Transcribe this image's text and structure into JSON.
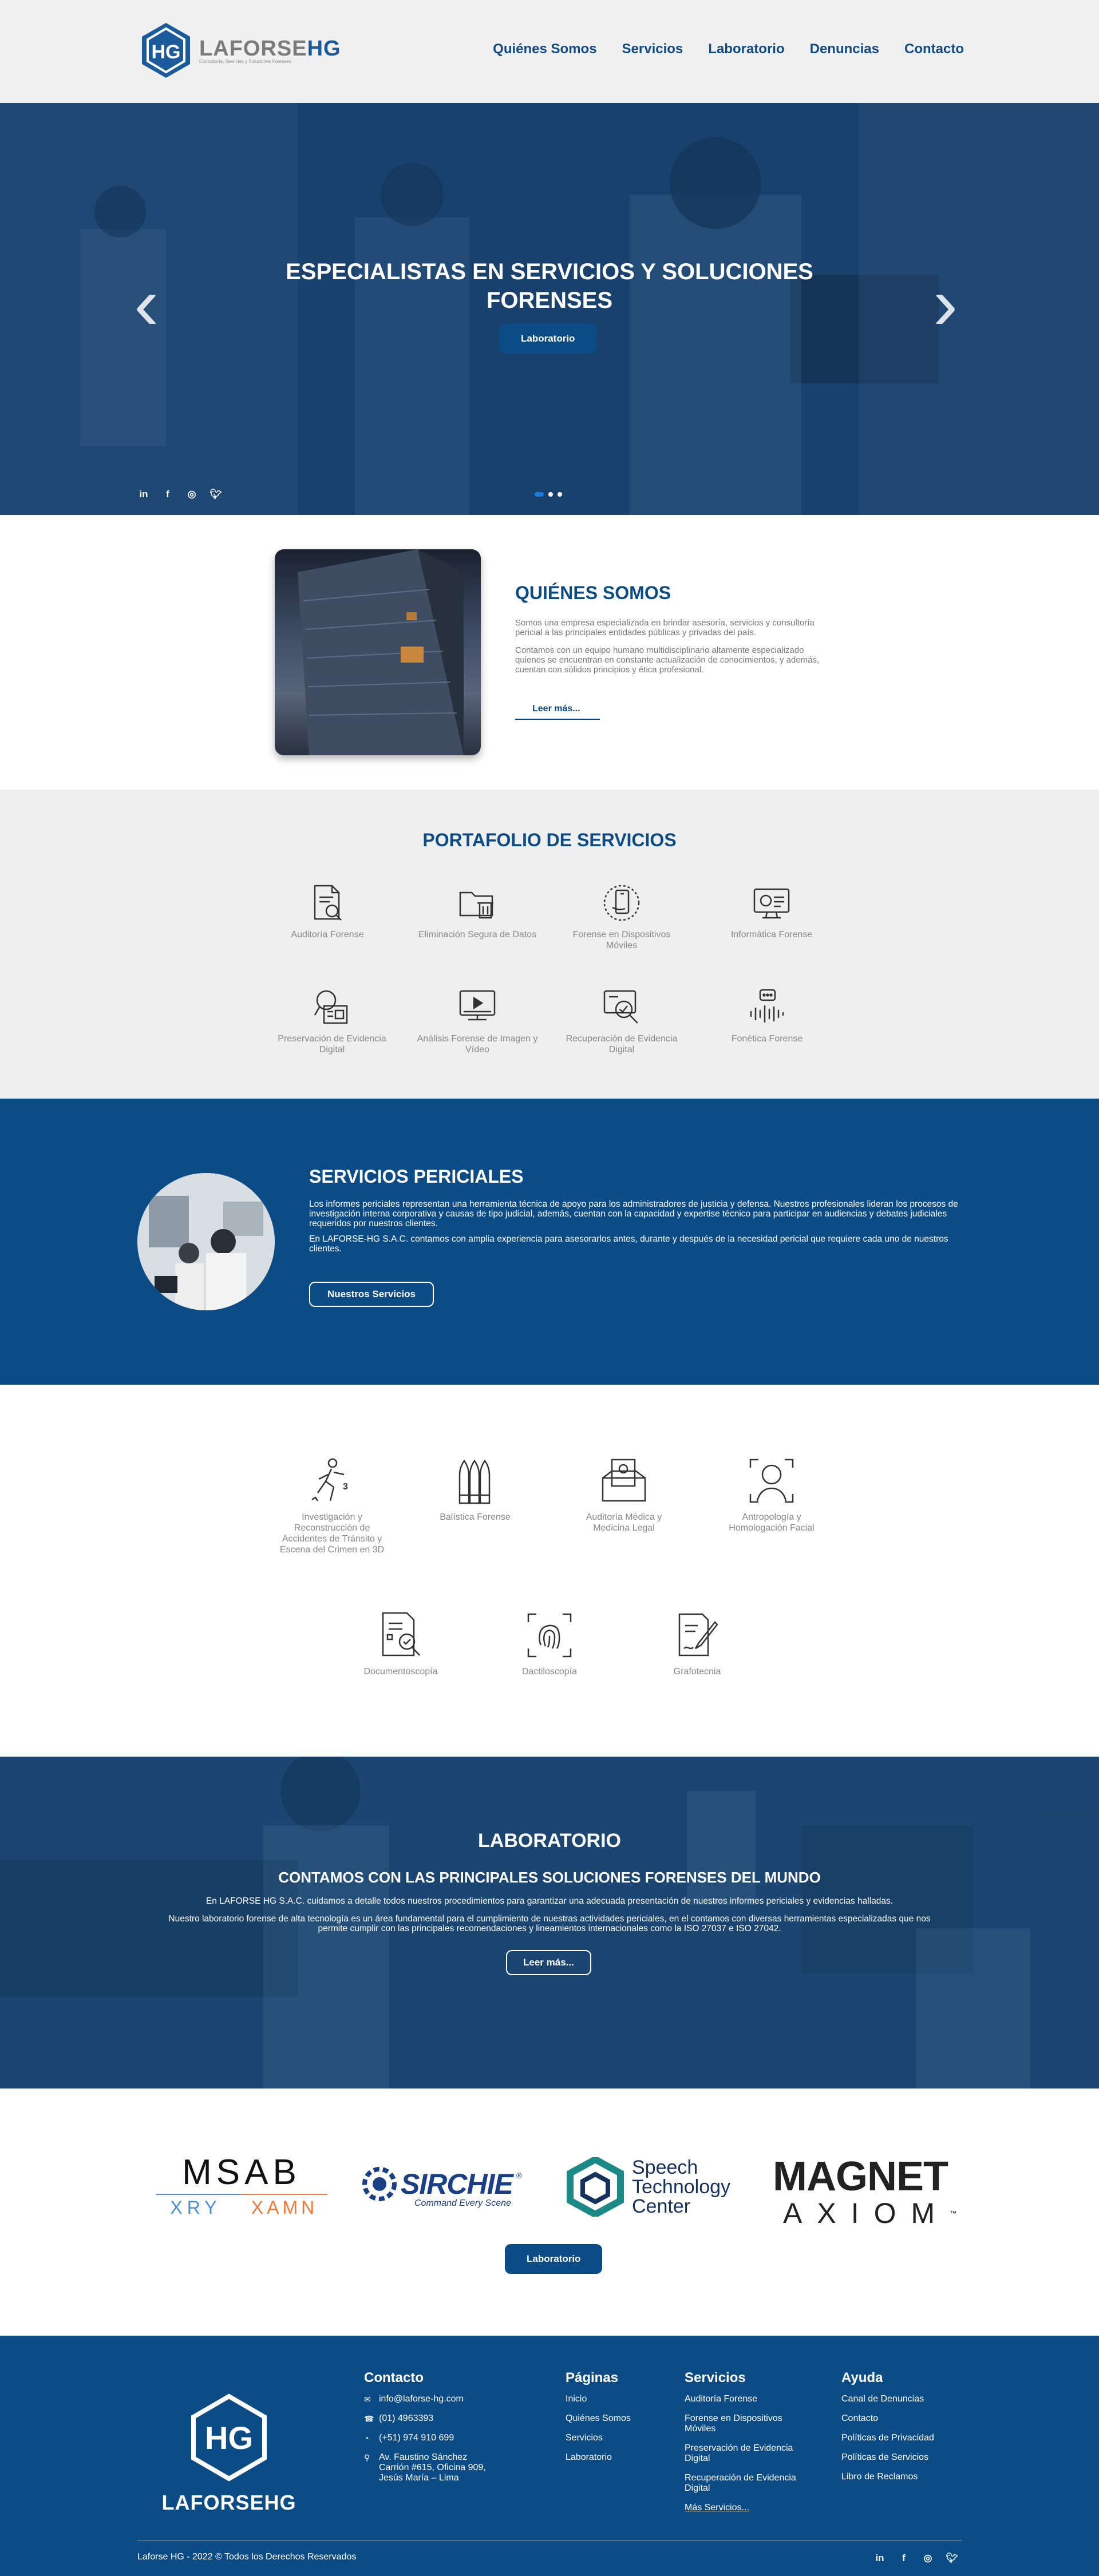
{
  "header": {
    "logo_text_a": "LAFORSE",
    "logo_text_b": "HG",
    "logo_sub": "Consultoría, Servicios y Soluciones Forenses",
    "nav": [
      "Quiénes Somos",
      "Servicios",
      "Laboratorio",
      "Denuncias",
      "Contacto"
    ]
  },
  "hero": {
    "title": "ESPECIALISTAS EN SERVICIOS Y SOLUCIONES FORENSES",
    "button": "Laboratorio",
    "prev_arrow": "‹",
    "next_arrow": "›",
    "slides": 3,
    "active_slide": 1
  },
  "about": {
    "title": "QUIÉNES SOMOS",
    "p1": "Somos una empresa especializada en brindar asesoría, servicios y consultoría pericial a las principales entidades públicas y privadas del país.",
    "p2": "Contamos con un equipo humano multidisciplinario altamente especializado quienes se encuentran en constante actualización de conocimientos, y además, cuentan con sólidos principios y ética profesional.",
    "link": "Leer más..."
  },
  "portfolio": {
    "title": "PORTAFOLIO DE SERVICIOS",
    "items": [
      {
        "label": "Auditoría Forense",
        "icon": "audit-icon"
      },
      {
        "label": "Eliminación Segura de Datos",
        "icon": "delete-folder-icon"
      },
      {
        "label": "Forense en Dispositivos Móviles",
        "icon": "mobile-forensic-icon"
      },
      {
        "label": "Informática Forense",
        "icon": "computer-forensic-icon"
      },
      {
        "label": "Preservación de Evidencia Digital",
        "icon": "preservation-icon"
      },
      {
        "label": "Análisis Forense de Imagen y Vídeo",
        "icon": "video-analysis-icon"
      },
      {
        "label": "Recuperación de Evidencia Digital",
        "icon": "recovery-icon"
      },
      {
        "label": "Fonética Forense",
        "icon": "phonetic-icon"
      }
    ]
  },
  "periciales": {
    "title": "SERVICIOS PERICIALES",
    "p1": "Los informes periciales representan una herramienta técnica de apoyo para los administradores de justicia y defensa. Nuestros profesionales lideran los procesos de investigación interna corporativa y causas de tipo judicial, además, cuentan con la capacidad y expertise técnico para participar en audiencias y debates judiciales requeridos por nuestros clientes.",
    "p2": "En LAFORSE-HG S.A.C. contamos con amplia experiencia para asesorarlos antes, durante y después de la necesidad pericial que requiere cada uno de nuestros clientes.",
    "button": "Nuestros Servicios",
    "items": [
      {
        "label": "Investigación y Reconstrucción de Accidentes de Tránsito y Escena del Crimen en 3D",
        "icon": "crime-scene-icon"
      },
      {
        "label": "Balística Forense",
        "icon": "ballistics-icon"
      },
      {
        "label": "Auditoría Médica y Medicina Legal",
        "icon": "medical-audit-icon"
      },
      {
        "label": "Antropología y Homologación Facial",
        "icon": "facial-icon"
      },
      {
        "label": "Documentoscopía",
        "icon": "document-icon"
      },
      {
        "label": "Dactiloscopía",
        "icon": "fingerprint-icon"
      },
      {
        "label": "Grafotecnia",
        "icon": "handwriting-icon"
      }
    ]
  },
  "laboratorio": {
    "title": "LABORATORIO",
    "subtitle": "CONTAMOS CON LAS PRINCIPALES SOLUCIONES FORENSES DEL MUNDO",
    "p1": "En LAFORSE HG S.A.C. cuidamos a detalle todos nuestros procedimientos para garantizar una adecuada presentación de nuestros informes periciales y evidencias halladas.",
    "p2": "Nuestro laboratorio forense de alta tecnología es un área fundamental para el cumplimiento de nuestras actividades periciales, en el contamos con diversas herramientas especializadas que nos permite cumplir con las principales recomendaciones y lineamientos internacionales como la ISO 27037 e ISO 27042.",
    "button": "Leer más..."
  },
  "partners": {
    "msab": "MSAB",
    "xry": "XRY",
    "xamn": "XAMN",
    "sirchie": "SIRCHIE",
    "sirchie_reg": "®",
    "sirchie_tag": "Command Every Scene",
    "stc1": "Speech",
    "stc2": "Technology",
    "stc3": "Center",
    "magnet": "MAGNET",
    "axiom": "AXIOM",
    "tm": "™",
    "button": "Laboratorio"
  },
  "footer": {
    "logo_a": "LAFORSE",
    "logo_b": "HG",
    "contact": {
      "title": "Contacto",
      "email": "info@laforse-hg.com",
      "phone": "(01) 4963393",
      "whatsapp": "(+51) 974 910 699",
      "address": "Av. Faustino Sánchez Carrión #615, Oficina 909, Jesús María – Lima"
    },
    "pages": {
      "title": "Páginas",
      "items": [
        "Inicio",
        "Quiénes Somos",
        "Servicios",
        "Laboratorio"
      ]
    },
    "services": {
      "title": "Servicios",
      "items": [
        "Auditoría Forense",
        "Forense en Dispositivos Móviles",
        "Preservación de Evidencia Digital",
        "Recuperación de Evidencia Digital",
        "Más Servicios..."
      ]
    },
    "help": {
      "title": "Ayuda",
      "items": [
        "Canal de Denuncias",
        "Contacto",
        "Políticas de Privacidad",
        "Políticas de Servicios",
        "Libro de Reclamos"
      ]
    },
    "copyright": "Laforse HG - 2022 © Todos los Derechos Reservados"
  },
  "colors": {
    "brand": "#0b4b86",
    "light_bg": "#efefef"
  }
}
